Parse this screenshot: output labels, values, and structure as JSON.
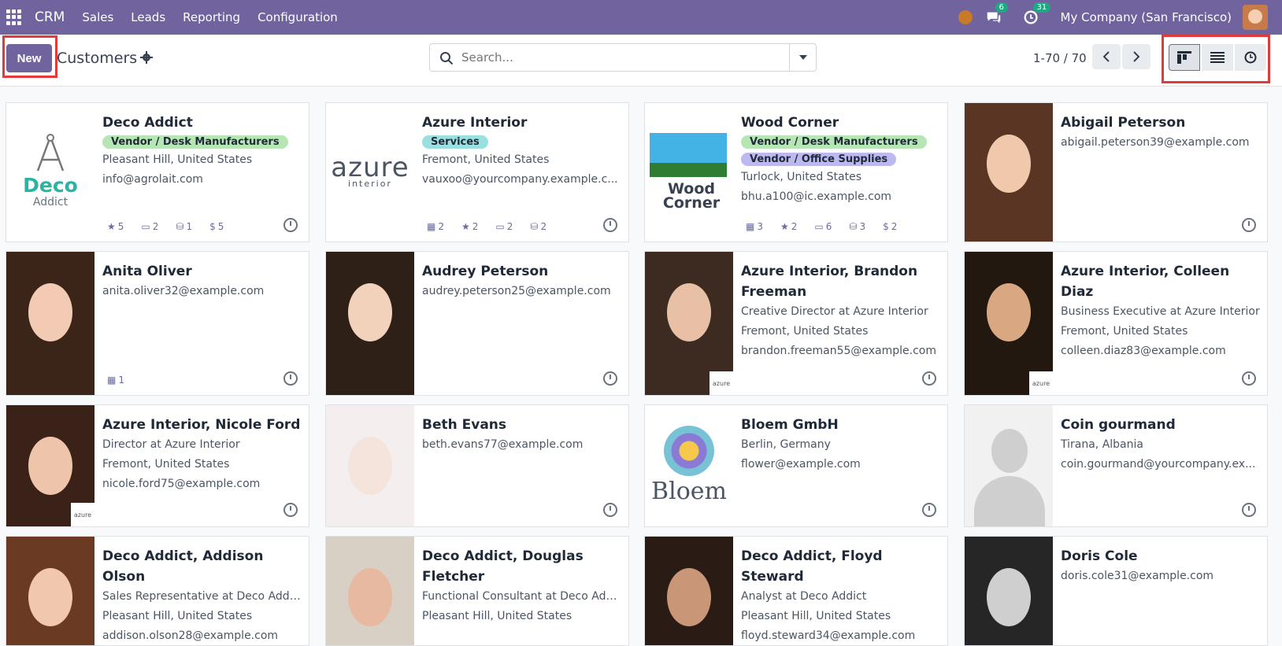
{
  "topbar": {
    "app_name": "CRM",
    "menu": [
      "Sales",
      "Leads",
      "Reporting",
      "Configuration"
    ],
    "messages_count": "6",
    "activities_count": "31",
    "company": "My Company (San Francisco)"
  },
  "control": {
    "new_label": "New",
    "title": "Customers",
    "search_placeholder": "Search...",
    "pager": "1-70 / 70"
  },
  "cards": [
    {
      "name": "Deco Addict",
      "tags": [
        "Vendor / Desk Manufacturers"
      ],
      "lines": [
        "Pleasant Hill, United States",
        "info@agrolait.com"
      ],
      "stats": [
        [
          "★",
          "5"
        ],
        [
          "▭",
          "2"
        ],
        [
          "⛁",
          "1"
        ],
        [
          "$",
          "5"
        ]
      ],
      "logo_big": "Deco",
      "logo_small": "Addict"
    },
    {
      "name": "Azure Interior",
      "tags": [
        "Services"
      ],
      "lines": [
        "Fremont, United States",
        "vauxoo@yourcompany.example.c..."
      ],
      "stats": [
        [
          "▦",
          "2"
        ],
        [
          "★",
          "2"
        ],
        [
          "▭",
          "2"
        ],
        [
          "⛁",
          "2"
        ]
      ],
      "logo_big": "azure",
      "logo_small": "interior"
    },
    {
      "name": "Wood Corner",
      "tags": [
        "Vendor / Desk Manufacturers",
        "Vendor / Office Supplies"
      ],
      "lines": [
        "Turlock, United States",
        "bhu.a100@ic.example.com"
      ],
      "stats": [
        [
          "▦",
          "3"
        ],
        [
          "★",
          "2"
        ],
        [
          "▭",
          "6"
        ],
        [
          "⛁",
          "3"
        ],
        [
          "$",
          "2"
        ]
      ],
      "logo_big": "Wood Corner"
    },
    {
      "name": "Abigail Peterson",
      "lines": [
        "abigail.peterson39@example.com"
      ]
    },
    {
      "name": "Anita Oliver",
      "lines": [
        "anita.oliver32@example.com"
      ],
      "stats": [
        [
          "▦",
          "1"
        ]
      ]
    },
    {
      "name": "Audrey Peterson",
      "lines": [
        "audrey.peterson25@example.com"
      ]
    },
    {
      "name": "Azure Interior, Brandon Freeman",
      "lines": [
        "Creative Director at Azure Interior",
        "Fremont, United States",
        "brandon.freeman55@example.com"
      ]
    },
    {
      "name": "Azure Interior, Colleen Diaz",
      "lines": [
        "Business Executive at Azure Interior",
        "Fremont, United States",
        "colleen.diaz83@example.com"
      ]
    },
    {
      "name": "Azure Interior, Nicole Ford",
      "lines": [
        "Director at Azure Interior",
        "Fremont, United States",
        "nicole.ford75@example.com"
      ]
    },
    {
      "name": "Beth Evans",
      "lines": [
        "beth.evans77@example.com"
      ]
    },
    {
      "name": "Bloem GmbH",
      "lines": [
        "Berlin, Germany",
        "flower@example.com"
      ],
      "logo_big": "Bloem"
    },
    {
      "name": "Coin gourmand",
      "lines": [
        "Tirana, Albania",
        "coin.gourmand@yourcompany.ex..."
      ]
    },
    {
      "name": "Deco Addict, Addison Olson",
      "lines": [
        "Sales Representative at Deco Addict",
        "Pleasant Hill, United States",
        "addison.olson28@example.com"
      ]
    },
    {
      "name": "Deco Addict, Douglas Fletcher",
      "lines": [
        "Functional Consultant at Deco Addict",
        "Pleasant Hill, United States"
      ]
    },
    {
      "name": "Deco Addict, Floyd Steward",
      "lines": [
        "Analyst at Deco Addict",
        "Pleasant Hill, United States",
        "floyd.steward34@example.com"
      ]
    },
    {
      "name": "Doris Cole",
      "lines": [
        "doris.cole31@example.com"
      ]
    }
  ],
  "colors": {
    "brand": "#71639e",
    "highlight": "#e23a3a"
  }
}
